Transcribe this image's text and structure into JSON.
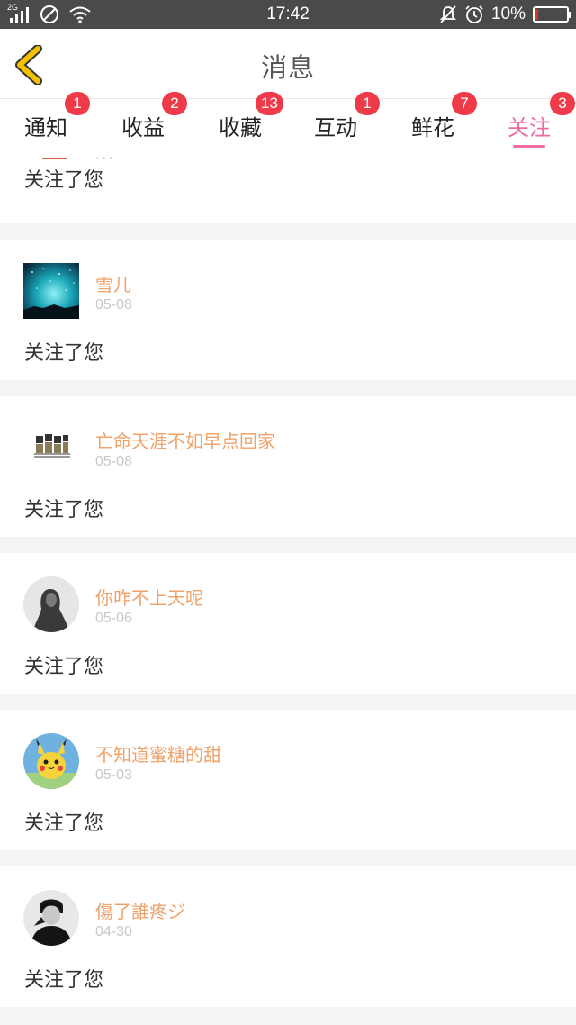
{
  "status_bar": {
    "network": "2G",
    "time": "17:42",
    "battery_text": "10%",
    "battery_level": 0.1
  },
  "header": {
    "title": "消息",
    "back_icon": "chevron-left-icon"
  },
  "tabs": [
    {
      "label": "通知",
      "badge": "1"
    },
    {
      "label": "收益",
      "badge": "2"
    },
    {
      "label": "收藏",
      "badge": "13"
    },
    {
      "label": "互动",
      "badge": "1"
    },
    {
      "label": "鲜花",
      "badge": "7"
    },
    {
      "label": "关注",
      "badge": "3",
      "active": true
    }
  ],
  "colors": {
    "accent": "#ee6aa3",
    "badge": "#ef3a4a",
    "username": "#f0a26a",
    "back_arrow": "#f2c200"
  },
  "follow_list": {
    "partial_item": {
      "message": "关注了您"
    },
    "items": [
      {
        "name": "雪儿",
        "date": "05-08",
        "message": "关注了您"
      },
      {
        "name": "亡命天涯不如早点回家",
        "date": "05-08",
        "message": "关注了您"
      },
      {
        "name": "你咋不上天呢",
        "date": "05-06",
        "message": "关注了您"
      },
      {
        "name": "不知道蜜糖的甜",
        "date": "05-03",
        "message": "关注了您"
      },
      {
        "name": "傷了誰疼ジ",
        "date": "04-30",
        "message": "关注了您"
      }
    ]
  }
}
